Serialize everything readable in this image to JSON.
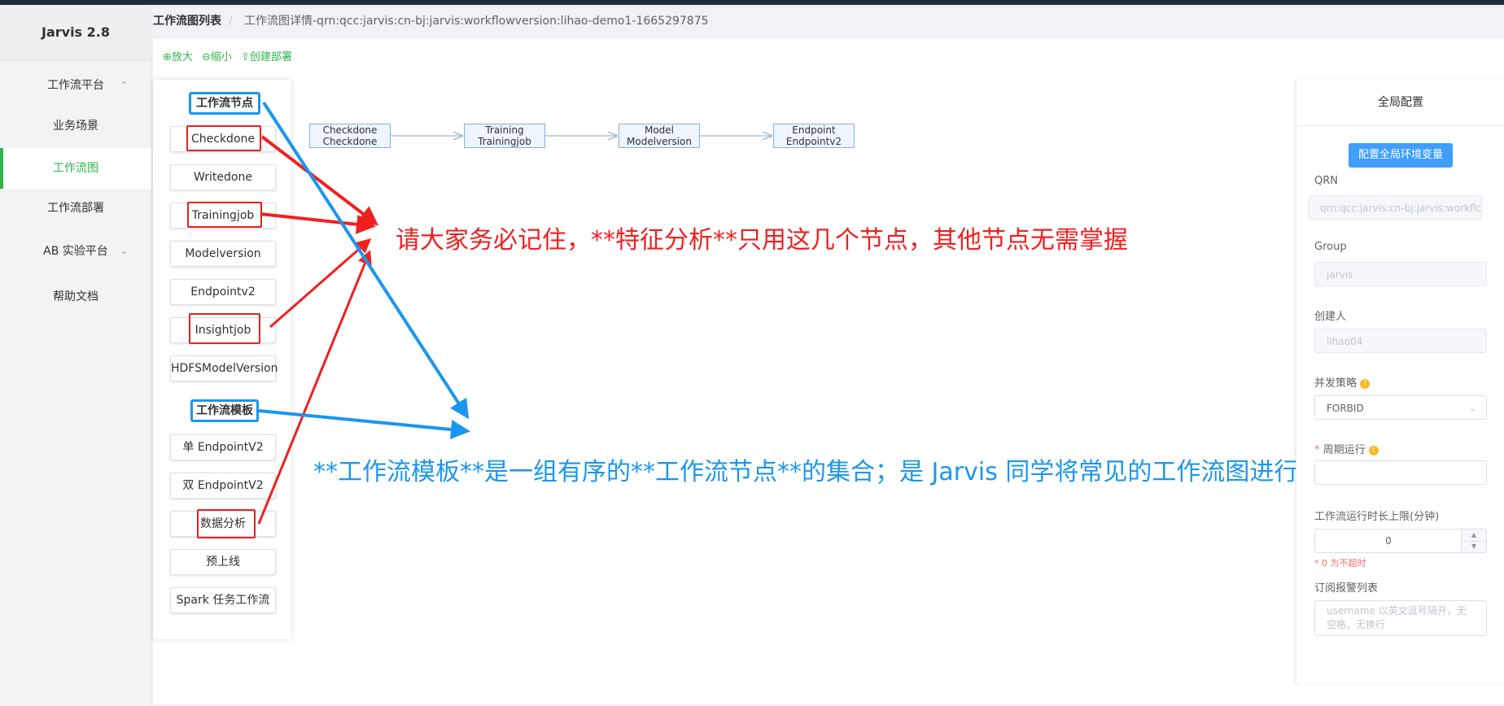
{
  "app": {
    "title": "Jarvis 2.8"
  },
  "sidebar": {
    "items": [
      {
        "label": "工作流平台",
        "chevron": "chevron-up-icon"
      },
      {
        "label": "业务场景"
      },
      {
        "label": "工作流图",
        "active": true
      },
      {
        "label": "工作流部署"
      },
      {
        "label": "AB 实验平台",
        "chevron": "chevron-down-icon"
      },
      {
        "label": "帮助文档"
      }
    ]
  },
  "breadcrumb": {
    "first": "工作流图列表",
    "separator": "/",
    "second": "工作流图详情-qrn:qcc:jarvis:cn-bj:jarvis:workflowversion:lihao-demo1-1665297875"
  },
  "toolbar": {
    "zoom_in": "⊕放大",
    "zoom_out": "⊖缩小",
    "create_deploy": "⇧创建部署"
  },
  "palette": {
    "nodes_title": "工作流节点",
    "nodes": [
      "Checkdone",
      "Writedone",
      "Trainingjob",
      "Modelversion",
      "Endpointv2",
      "Insightjob",
      "HDFSModelVersion"
    ],
    "templates_title": "工作流模板",
    "templates": [
      "单 EndpointV2",
      "双 EndpointV2",
      "数据分析",
      "预上线",
      "Spark 任务工作流"
    ]
  },
  "flow": {
    "nodes": [
      {
        "line1": "Checkdone",
        "line2": "Checkdone"
      },
      {
        "line1": "Training",
        "line2": "Trainingjob"
      },
      {
        "line1": "Model",
        "line2": "Modelversion"
      },
      {
        "line1": "Endpoint",
        "line2": "Endpointv2"
      }
    ]
  },
  "config": {
    "title": "全局配置",
    "env_button": "配置全局环境变量",
    "qrn_label": "QRN",
    "qrn_value": "qrn:qcc:jarvis:cn-bj:jarvis:workflc",
    "group_label": "Group",
    "group_value": "jarvis",
    "creator_label": "创建人",
    "creator_value": "lihao04",
    "concurrency_label": "并发策略",
    "concurrency_value": "FORBID",
    "schedule_label": "周期运行",
    "required_mark": "*",
    "timeout_label": "工作流运行时长上限(分钟)",
    "timeout_value": "0",
    "timeout_hint": "* 0 为不超时",
    "subscribe_label": "订阅报警列表",
    "subscribe_placeholder": "username 以英文逗号隔开，无空格，无换行"
  },
  "annotations": {
    "red_note": "请大家务必记住，**特征分析**只用这几个节点，其他节点无需掌握",
    "blue_note": "**工作流模板**是一组有序的**工作流节点**的集合；是 Jarvis 同学将常见的工作流图进行了归纳总结。"
  },
  "colors": {
    "brand_green": "#2fb34a",
    "primary_blue": "#409eff",
    "annotation_red": "#f0201f",
    "annotation_blue": "#1a96f0"
  }
}
